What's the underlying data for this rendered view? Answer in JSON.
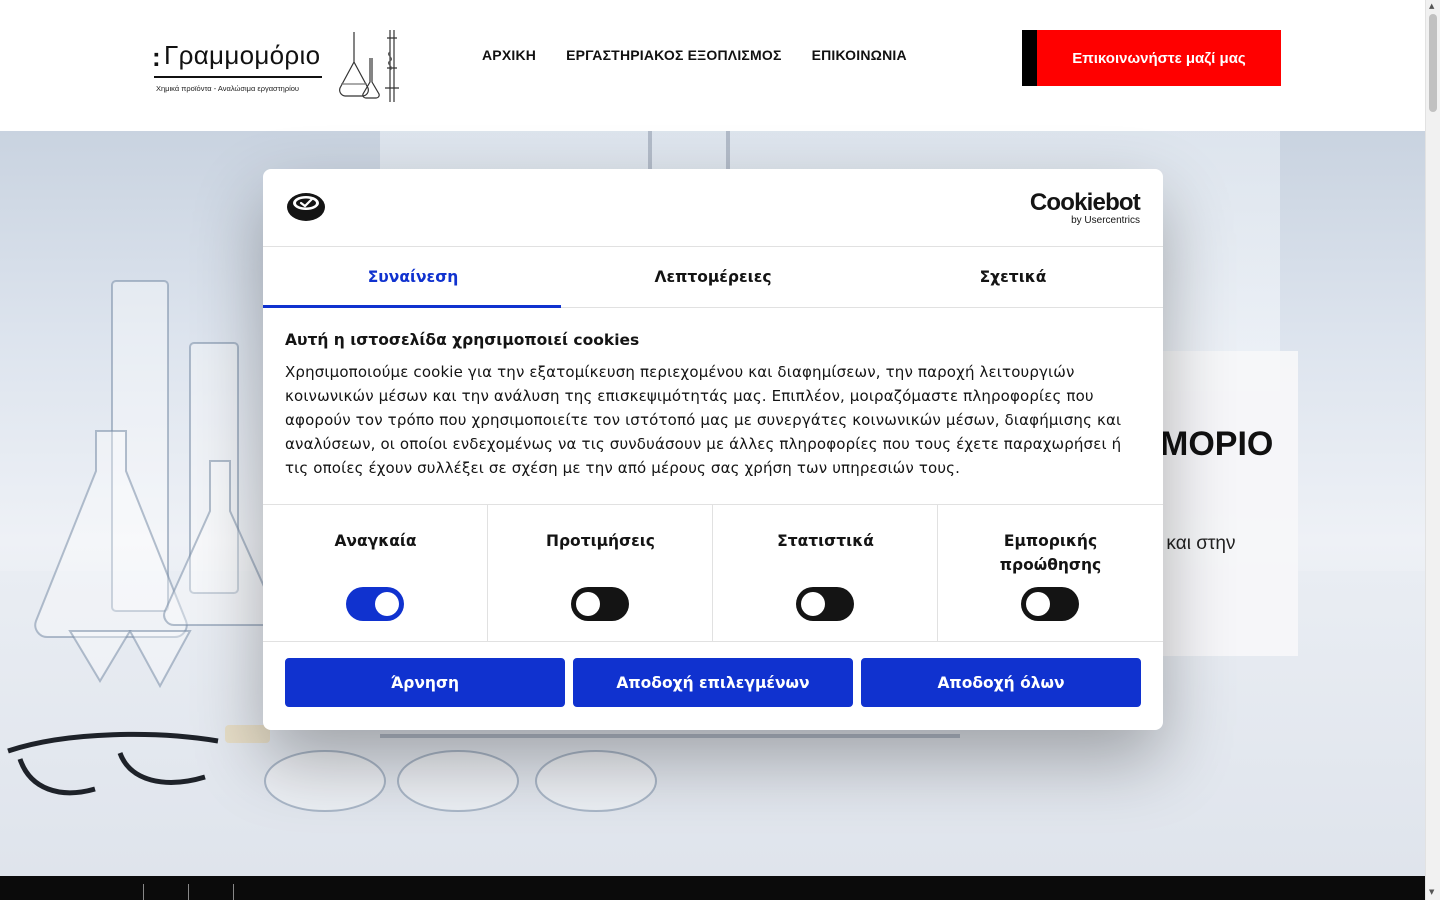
{
  "site": {
    "logo": {
      "title": "Γραμμομόριο",
      "tagline": "Χημικά προϊόντα - Αναλώσιμα εργαστηρίου"
    },
    "nav": [
      "ΑΡΧΙΚΗ",
      "ΕΡΓΑΣΤΗΡΙΑΚΟΣ ΕΞΟΠΛΙΣΜΟΣ",
      "ΕΠΙΚΟΙΝΩΝΙΑ"
    ],
    "cta_label": "Επικοινωνήστε μαζί μας",
    "hero": {
      "title_fragment": "ΜΟΡΙΟ",
      "text_fragment": "ς και στην"
    }
  },
  "cookie_dialog": {
    "brand": "Cookiebot",
    "brand_sub": "by Usercentrics",
    "tabs": [
      "Συναίνεση",
      "Λεπτομέρειες",
      "Σχετικά"
    ],
    "active_tab": 0,
    "heading": "Αυτή η ιστοσελίδα χρησιμοποιεί cookies",
    "body": "Χρησιμοποιούμε cookie για την εξατομίκευση περιεχομένου και διαφημίσεων, την παροχή λειτουργιών κοινωνικών μέσων και την ανάλυση της επισκεψιμότητάς μας. Επιπλέον, μοιραζόμαστε πληροφορίες που αφορούν τον τρόπο που χρησιμοποιείτε τον ιστότοπό μας με συνεργάτες κοινωνικών μέσων, διαφήμισης και αναλύσεων, οι οποίοι ενδεχομένως να τις συνδυάσουν με άλλες πληροφορίες που τους έχετε παραχωρήσει ή τις οποίες έχουν συλλέξει σε σχέση με την από μέρους σας χρήση των υπηρεσιών τους.",
    "categories": [
      {
        "label": "Αναγκαία",
        "enabled": true
      },
      {
        "label": "Προτιμήσεις",
        "enabled": false
      },
      {
        "label": "Στατιστικά",
        "enabled": false
      },
      {
        "label": "Εμπορικής προώθησης",
        "enabled": false
      }
    ],
    "buttons": {
      "deny": "Άρνηση",
      "allow_selected": "Αποδοχή επιλεγμένων",
      "allow_all": "Αποδοχή όλων"
    }
  },
  "colors": {
    "accent_blue": "#1032cf",
    "cta_red": "#ff0000",
    "text_dark": "#141414"
  }
}
